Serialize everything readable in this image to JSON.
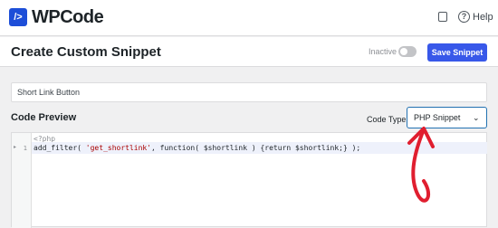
{
  "app": {
    "logo_glyph": "/>",
    "name": "WPCode"
  },
  "header": {
    "help_label": "Help"
  },
  "page": {
    "title": "Create Custom Snippet",
    "status_label": "Inactive",
    "save_button": "Save Snippet"
  },
  "snippet": {
    "title_value": "Short Link Button"
  },
  "code_preview": {
    "title": "Code Preview",
    "code_type_label": "Code Type",
    "code_type_value": "PHP Snippet",
    "line0": "<?php",
    "line_number": "1",
    "line1_pre": "add_filter( ",
    "line1_str": "'get_shortlink'",
    "line1_post": ", function( $shortlink ) {return $shortlink;} );"
  },
  "colors": {
    "accent": "#3858e9",
    "annotation": "#e01e2f"
  },
  "icons": [
    "screen-options-icon",
    "help-icon",
    "chevron-down-icon",
    "fold-arrow-icon",
    "annotation-arrow-icon"
  ]
}
